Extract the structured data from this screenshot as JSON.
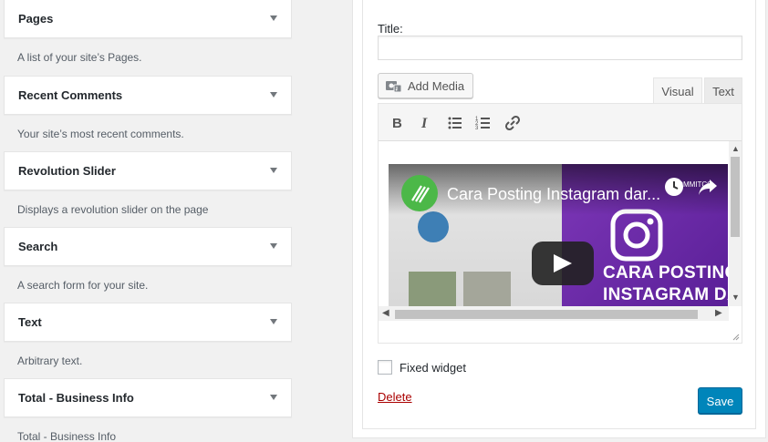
{
  "widgets": [
    {
      "title": "Pages",
      "description": "A list of your site’s Pages."
    },
    {
      "title": "Recent Comments",
      "description": "Your site’s most recent comments."
    },
    {
      "title": "Revolution Slider",
      "description": "Displays a revolution slider on the page"
    },
    {
      "title": "Search",
      "description": "A search form for your site."
    },
    {
      "title": "Text",
      "description": "Arbitrary text."
    },
    {
      "title": "Total - Business Info",
      "description": "Total - Business Info"
    }
  ],
  "form": {
    "title_label": "Title:",
    "title_value": "",
    "add_media_label": "Add Media",
    "tab_visual": "Visual",
    "tab_text": "Text",
    "fixed_widget_label": "Fixed widget",
    "delete_label": "Delete",
    "save_label": "Save"
  },
  "video": {
    "title": "Cara Posting Instagram dar...",
    "overlay_line1": "CARA POSTING",
    "overlay_line2": "INSTAGRAM DARI",
    "corner_text": "TOMMITCO"
  },
  "toolbar": {
    "buttons": [
      "bold-icon",
      "italic-icon",
      "bullet-list-icon",
      "numbered-list-icon",
      "link-icon"
    ]
  },
  "colors": {
    "primary_button": "#0085ba",
    "delete_link": "#aa0000",
    "video_purple": "#7d37b8",
    "channel_green": "#4cb848"
  }
}
